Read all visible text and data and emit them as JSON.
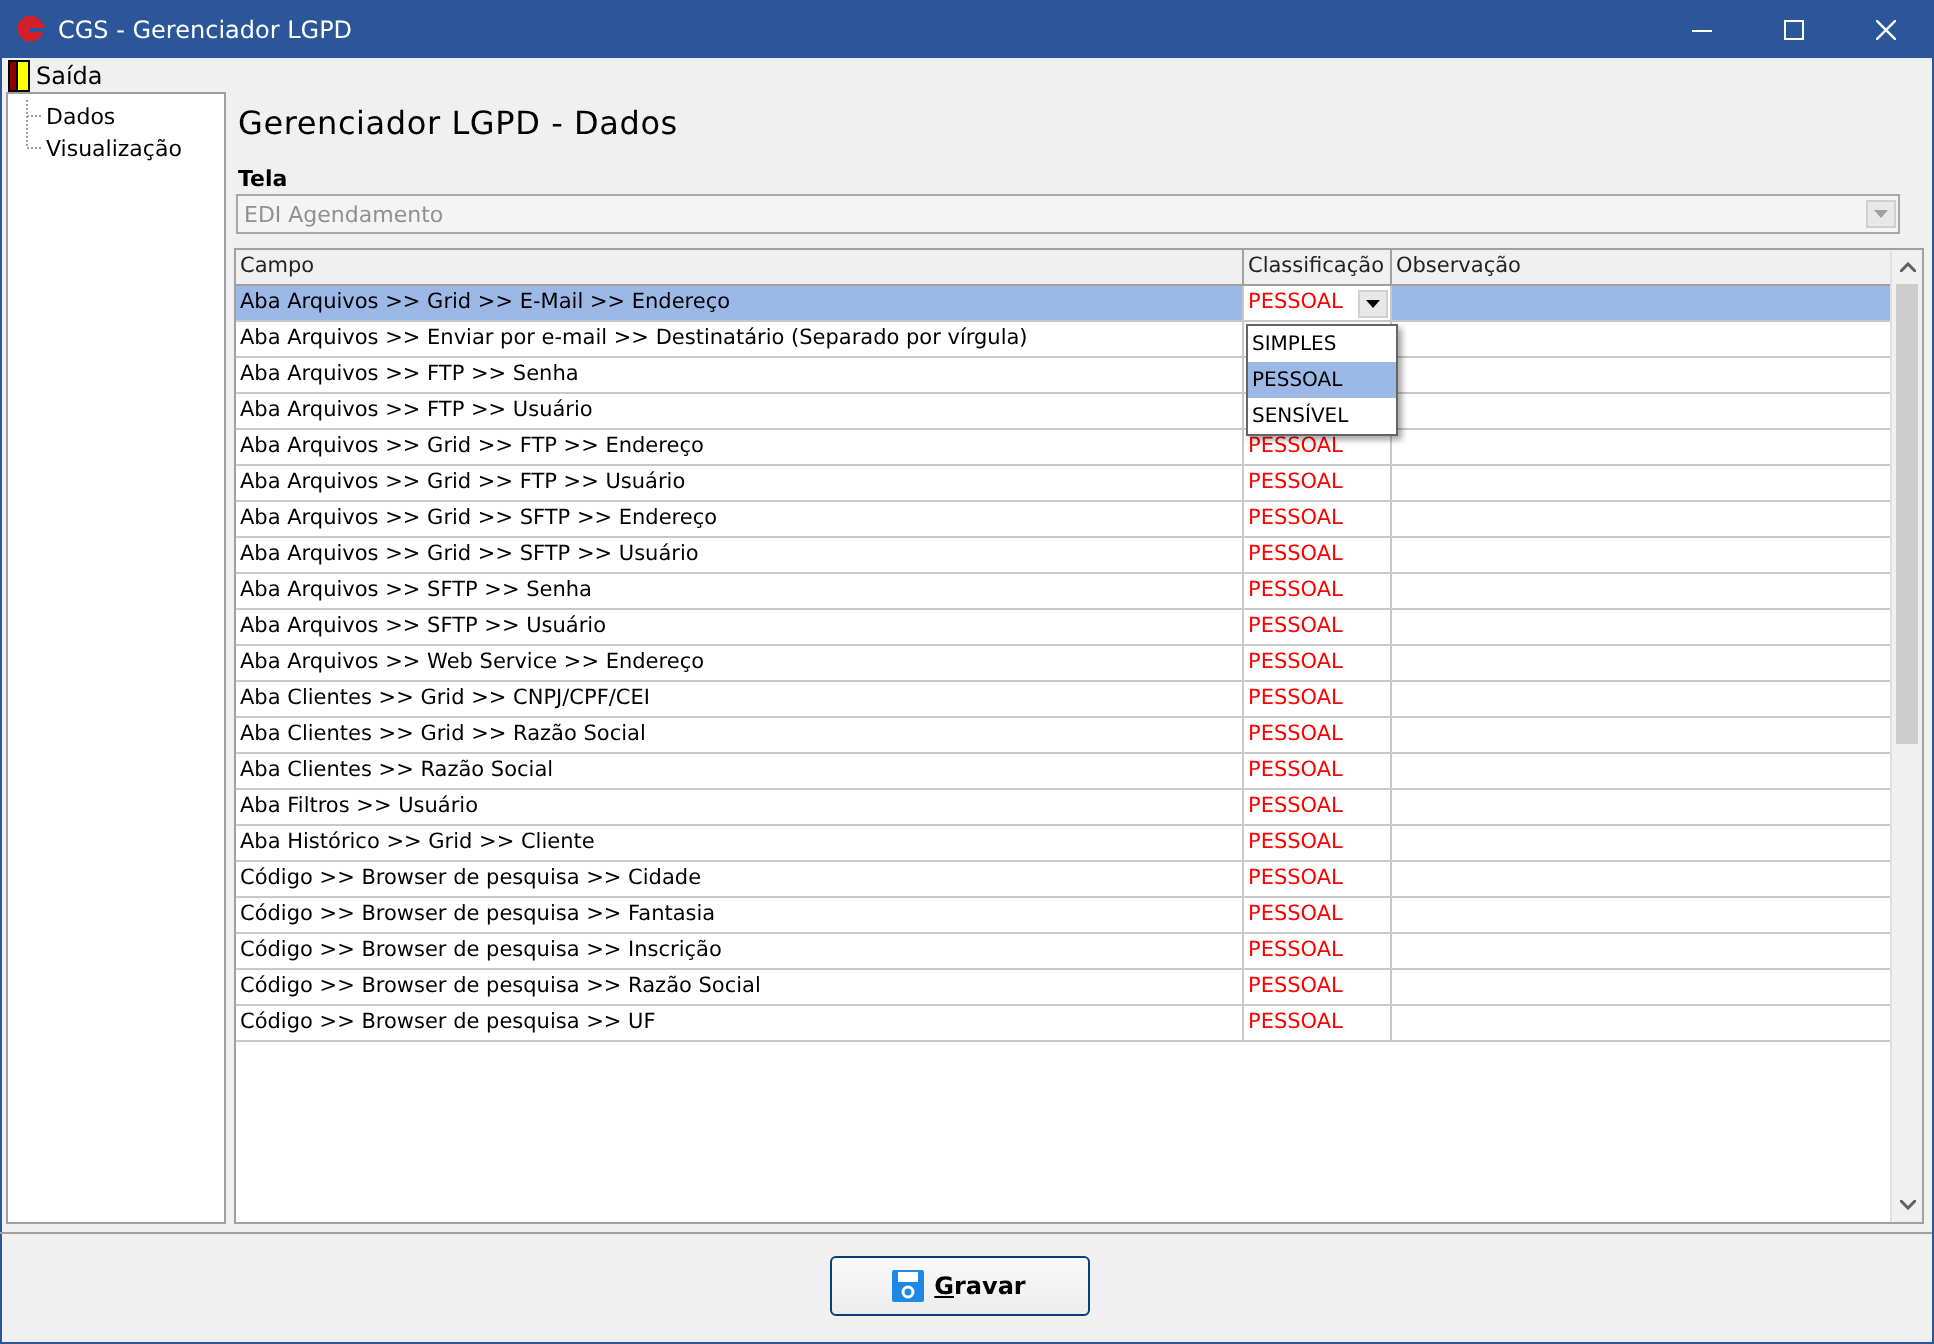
{
  "window": {
    "title": "CGS - Gerenciador LGPD"
  },
  "menu": [
    {
      "label": "Saída"
    }
  ],
  "sidebar": {
    "items": [
      {
        "label": "Dados",
        "selected": false
      },
      {
        "label": "Visualização",
        "selected": false
      }
    ]
  },
  "heading": "Gerenciador LGPD - Dados",
  "tela": {
    "label": "Tela",
    "value": "EDI Agendamento",
    "disabled": true
  },
  "table": {
    "columns": [
      "Campo",
      "Classificação",
      "Observação"
    ],
    "rows": [
      {
        "campo": "Aba Arquivos  >> Grid >> E-Mail >> Endereço",
        "classificacao": "PESSOAL",
        "selected": true,
        "editing": true
      },
      {
        "campo": "Aba Arquivos >> Enviar por e-mail >> Destinatário (Separado por vírgula)",
        "selected": false,
        "editing": false
      },
      {
        "campo": "Aba Arquivos >> FTP >> Senha",
        "selected": false,
        "editing": false
      },
      {
        "campo": "Aba Arquivos >> FTP >> Usuário",
        "selected": false,
        "editing": false
      },
      {
        "campo": "Aba Arquivos >> Grid >> FTP >>  Endereço",
        "classificacao": "PESSOAL",
        "selected": false,
        "editing": false
      },
      {
        "campo": "Aba Arquivos >> Grid >> FTP >> Usuário",
        "classificacao": "PESSOAL",
        "selected": false,
        "editing": false
      },
      {
        "campo": "Aba Arquivos >> Grid >> SFTP >> Endereço",
        "classificacao": "PESSOAL",
        "selected": false,
        "editing": false
      },
      {
        "campo": "Aba Arquivos >> Grid >> SFTP >> Usuário",
        "classificacao": "PESSOAL",
        "selected": false,
        "editing": false
      },
      {
        "campo": "Aba Arquivos >> SFTP >> Senha",
        "classificacao": "PESSOAL",
        "selected": false,
        "editing": false
      },
      {
        "campo": "Aba Arquivos >> SFTP >> Usuário",
        "classificacao": "PESSOAL",
        "selected": false,
        "editing": false
      },
      {
        "campo": "Aba Arquivos >> Web Service >> Endereço",
        "classificacao": "PESSOAL",
        "selected": false,
        "editing": false
      },
      {
        "campo": "Aba Clientes >> Grid >> CNPJ/CPF/CEI",
        "classificacao": "PESSOAL",
        "selected": false,
        "editing": false
      },
      {
        "campo": "Aba Clientes >> Grid >> Razão Social",
        "classificacao": "PESSOAL",
        "selected": false,
        "editing": false
      },
      {
        "campo": "Aba Clientes >> Razão Social",
        "classificacao": "PESSOAL",
        "selected": false,
        "editing": false
      },
      {
        "campo": "Aba Filtros >> Usuário",
        "classificacao": "PESSOAL",
        "selected": false,
        "editing": false
      },
      {
        "campo": "Aba Histórico >> Grid >> Cliente",
        "classificacao": "PESSOAL",
        "selected": false,
        "editing": false
      },
      {
        "campo": "Código >> Browser de pesquisa >> Cidade",
        "classificacao": "PESSOAL",
        "selected": false,
        "editing": false
      },
      {
        "campo": "Código >> Browser de pesquisa >> Fantasia",
        "classificacao": "PESSOAL",
        "selected": false,
        "editing": false
      },
      {
        "campo": "Código >> Browser de pesquisa >> Inscrição",
        "classificacao": "PESSOAL",
        "selected": false,
        "editing": false
      },
      {
        "campo": "Código >> Browser de pesquisa >> Razão Social",
        "classificacao": "PESSOAL",
        "selected": false,
        "editing": false
      },
      {
        "campo": "Código >> Browser de pesquisa >> UF",
        "classificacao": "PESSOAL",
        "selected": false,
        "editing": false
      }
    ],
    "dropdown": {
      "options": [
        {
          "label": "SIMPLES",
          "selected": false
        },
        {
          "label": "PESSOAL",
          "selected": true
        },
        {
          "label": "SENSÍVEL",
          "selected": false
        }
      ]
    }
  },
  "button": {
    "label": "Gravar"
  }
}
